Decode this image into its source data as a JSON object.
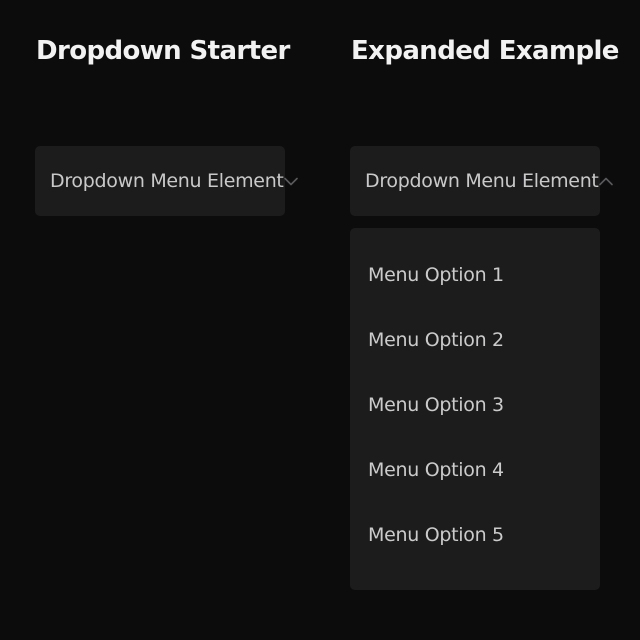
{
  "starter": {
    "title": "Dropdown Starter",
    "dropdown_label": "Dropdown Menu Element",
    "chevron_icon": "chevron-down-icon"
  },
  "expanded": {
    "title": "Expanded Example",
    "dropdown_label": "Dropdown Menu Element",
    "chevron_icon": "chevron-up-icon",
    "options": [
      {
        "label": "Menu Option 1"
      },
      {
        "label": "Menu Option 2"
      },
      {
        "label": "Menu Option 3"
      },
      {
        "label": "Menu Option 4"
      },
      {
        "label": "Menu Option 5"
      }
    ]
  },
  "colors": {
    "background": "#0c0c0d",
    "surface": "#1c1c1d",
    "title_text": "#f2f2f2",
    "body_text": "#c9c9c9",
    "chevron": "#5a5a5c"
  }
}
